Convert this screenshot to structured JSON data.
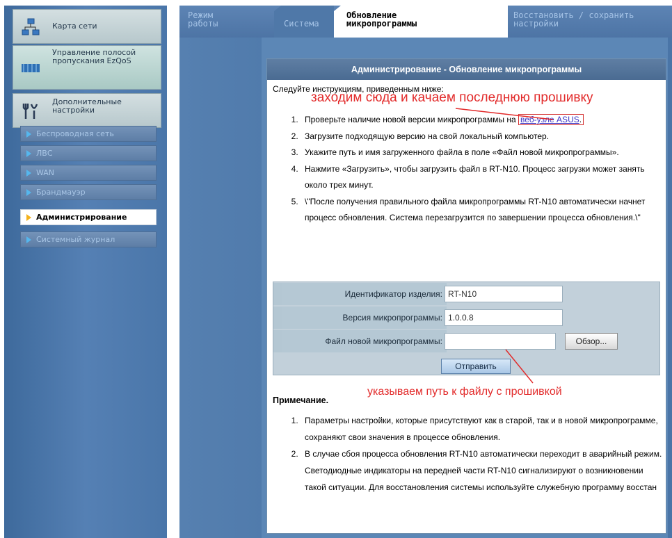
{
  "sidebar": {
    "big_items": [
      {
        "label": "Карта сети",
        "icon": "network-map-icon"
      },
      {
        "label": "Управление полосой пропускания EzQoS",
        "icon": "ezqos-icon"
      },
      {
        "label": "Дополнительные настройки",
        "icon": "advanced-settings-icon"
      }
    ],
    "items": [
      {
        "label": "Беспроводная сеть"
      },
      {
        "label": "ЛВС"
      },
      {
        "label": "WAN"
      },
      {
        "label": "Брандмауэр"
      },
      {
        "label": "Администрирование",
        "active": true
      },
      {
        "label": "Системный журнал"
      }
    ]
  },
  "tabs": [
    {
      "label_line1": "Режим",
      "label_line2": "работы"
    },
    {
      "label_line1": "Система",
      "label_line2": ""
    },
    {
      "label_line1": "Обновление",
      "label_line2": "микропрограммы",
      "selected": true
    },
    {
      "label_line1": "Восстановить / сохранить",
      "label_line2": "настройки"
    }
  ],
  "panel": {
    "title": "Администрирование - Обновление микропрограммы",
    "intro": "Следуйте инструкциям, приведенным ниже:",
    "steps": {
      "s1_before": "Проверьте наличие новой версии микропрограммы на",
      "s1_link": "веб-узле ASUS",
      "s1_after": ".",
      "s2": "Загрузите подходящую версию на свой локальный компьютер.",
      "s3": "Укажите путь и имя загруженного файла в поле «Файл новой микропрограммы».",
      "s4": "Нажмите «Загрузить», чтобы загрузить файл в RT-N10. Процесс загрузки может занять около трех минут.",
      "s5": "\\\"После получения правильного файла микропрограммы RT-N10 автоматически начнет процесс обновления. Система перезагрузится по завершении процесса обновления.\\\""
    },
    "form": {
      "product_id_label": "Идентификатор изделия:",
      "product_id_value": "RT-N10",
      "fw_version_label": "Версия микропрограммы:",
      "fw_version_value": "1.0.0.8",
      "new_fw_label": "Файл новой микропрограммы:",
      "new_fw_value": "",
      "browse_label": "Обзор...",
      "submit_label": "Отправить"
    },
    "note_title": "Примечание.",
    "notes": [
      "Параметры настройки, которые присутствуют как в старой, так и в новой микропрограмме, сохраняют свои значения в процессе обновления.",
      "В случае сбоя процесса обновления RT-N10 автоматически переходит в аварийный режим. Светодиодные индикаторы на передней части RT-N10 сигнализируют о возникновении такой ситуации. Для восстановления системы используйте служебную программу восстан"
    ]
  },
  "annotations": {
    "top": "заходим сюда и качаем последнюю прошивку",
    "bottom": "указываем путь к файлу с прошивкой",
    "color": "#e22a2a"
  }
}
